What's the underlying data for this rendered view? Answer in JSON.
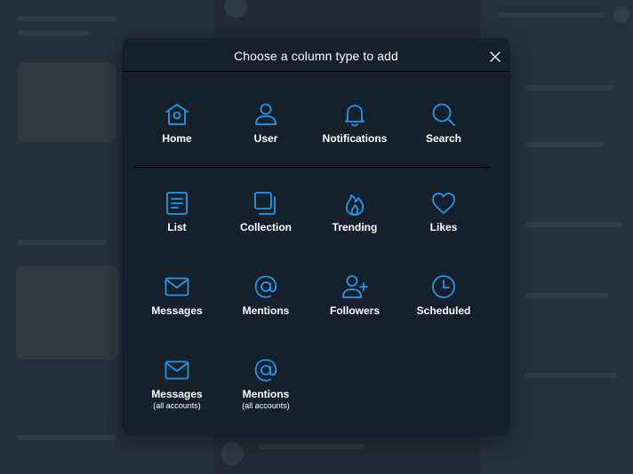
{
  "dialog": {
    "title": "Choose a column type to add",
    "close_icon": "close-icon"
  },
  "column_types": [
    {
      "label": "Home",
      "icon": "home-icon"
    },
    {
      "label": "User",
      "icon": "user-icon"
    },
    {
      "label": "Notifications",
      "icon": "bell-icon"
    },
    {
      "label": "Search",
      "icon": "search-icon"
    },
    {
      "label": "List",
      "icon": "list-icon"
    },
    {
      "label": "Collection",
      "icon": "collection-icon"
    },
    {
      "label": "Trending",
      "icon": "flame-icon"
    },
    {
      "label": "Likes",
      "icon": "heart-icon"
    },
    {
      "label": "Messages",
      "icon": "envelope-icon"
    },
    {
      "label": "Mentions",
      "icon": "at-icon"
    },
    {
      "label": "Followers",
      "icon": "add-user-icon"
    },
    {
      "label": "Scheduled",
      "icon": "clock-icon"
    },
    {
      "label": "Messages",
      "sublabel": "(all accounts)",
      "icon": "envelope-icon"
    },
    {
      "label": "Mentions",
      "sublabel": "(all accounts)",
      "icon": "at-icon"
    }
  ],
  "colors": {
    "accent": "#1d9bf0",
    "dialog_bg": "#15202b",
    "text": "#ffffff"
  }
}
